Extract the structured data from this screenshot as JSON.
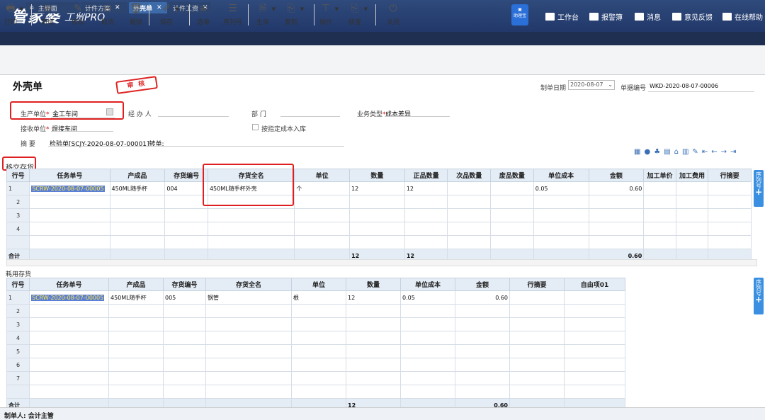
{
  "app": {
    "logo": "管家婆",
    "logo_sub": "工贸PRO",
    "assistant": "助理宝"
  },
  "topnav": [
    {
      "label": "工作台",
      "icon": "monitor-icon"
    },
    {
      "label": "报警簿",
      "icon": "alarm-icon"
    },
    {
      "label": "消息",
      "icon": "mail-icon"
    },
    {
      "label": "意见反馈",
      "icon": "edit-icon"
    },
    {
      "label": "在线帮助",
      "icon": "user-icon"
    }
  ],
  "tabs": [
    {
      "label": "主界面"
    },
    {
      "label": "计件方案"
    },
    {
      "label": "外壳单"
    },
    {
      "label": "计件工资"
    }
  ],
  "toolbar": [
    {
      "label": "打印",
      "icon": "print-icon",
      "glyph": "🖶"
    },
    {
      "label": "新增",
      "icon": "plus-circle-icon",
      "glyph": "⊕"
    },
    {
      "label": "修改",
      "icon": "edit-icon",
      "glyph": "✎"
    },
    {
      "label": "取消",
      "icon": "minus-circle-icon",
      "glyph": "⊖"
    },
    {
      "label": "删除",
      "icon": "trash-icon",
      "glyph": "🗑"
    },
    {
      "label": "保存",
      "icon": "save-icon",
      "glyph": "✐"
    },
    {
      "label": "选单",
      "icon": "select-icon",
      "glyph": "≡"
    },
    {
      "label": "序列号",
      "icon": "list-icon",
      "glyph": "☰"
    },
    {
      "label": "生单",
      "icon": "doc-icon",
      "glyph": "🗎"
    },
    {
      "label": "复制",
      "icon": "copy-icon",
      "glyph": "⎘"
    },
    {
      "label": "操作",
      "icon": "operate-icon",
      "glyph": "⊤"
    },
    {
      "label": "联查",
      "icon": "query-icon",
      "glyph": "⎘"
    },
    {
      "label": "关闭",
      "icon": "power-icon",
      "glyph": "⏻"
    }
  ],
  "header": {
    "title": "外壳单",
    "audit_stamp": "审 核",
    "date_label": "制单日期",
    "date_value": "2020-08-07",
    "no_label": "单据编号",
    "no_value": "WKD-2020-08-07-00006"
  },
  "form": {
    "prod_unit_label": "生产单位",
    "prod_unit_value": "金工车间",
    "handler_label": "经 办 人",
    "dept_label": "部  门",
    "biz_type_label": "业务类型",
    "biz_type_value": "成本差异",
    "recv_unit_label": "接收单位",
    "recv_unit_value": "焊接车间",
    "checkbox_label": "按指定成本入库",
    "summary_label": "摘  要",
    "summary_value": "检验单[SCJY-2020-08-07-00001]转单:"
  },
  "grid1": {
    "section": "移交存货",
    "columns": [
      "行号",
      "任务单号",
      "产成品",
      "存货编号",
      "存货全名",
      "单位",
      "数量",
      "正品数量",
      "次品数量",
      "废品数量",
      "单位成本",
      "金额",
      "加工单价",
      "加工费用",
      "行摘要"
    ],
    "rows": [
      [
        "1",
        "SCRW-2020-08-07-00005",
        "450ML随手杯",
        "004",
        "450ML随手杯外壳",
        "个",
        "12",
        "12",
        "",
        "",
        "0.05",
        "0.60",
        "",
        "",
        ""
      ],
      [
        "2",
        "",
        "",
        "",
        "",
        "",
        "",
        "",
        "",
        "",
        "",
        "",
        "",
        "",
        ""
      ],
      [
        "3",
        "",
        "",
        "",
        "",
        "",
        "",
        "",
        "",
        "",
        "",
        "",
        "",
        "",
        ""
      ],
      [
        "4",
        "",
        "",
        "",
        "",
        "",
        "",
        "",
        "",
        "",
        "",
        "",
        "",
        "",
        ""
      ],
      [
        "",
        "",
        "",
        "",
        "",
        "",
        "",
        "",
        "",
        "",
        "",
        "",
        "",
        "",
        ""
      ]
    ],
    "sum": [
      "合计",
      "",
      "",
      "",
      "",
      "",
      "12",
      "12",
      "",
      "",
      "",
      "0.60",
      "",
      "",
      ""
    ],
    "side_btn": "序列号"
  },
  "grid2": {
    "section": "耗用存货",
    "columns": [
      "行号",
      "任务单号",
      "产成品",
      "存货编号",
      "存货全名",
      "单位",
      "数量",
      "单位成本",
      "金额",
      "行摘要",
      "自由项01"
    ],
    "rows": [
      [
        "1",
        "SCRW-2020-08-07-00005",
        "450ML随手杯",
        "005",
        "钢管",
        "根",
        "12",
        "0.05",
        "0.60",
        "",
        ""
      ],
      [
        "2",
        "",
        "",
        "",
        "",
        "",
        "",
        "",
        "",
        "",
        ""
      ],
      [
        "3",
        "",
        "",
        "",
        "",
        "",
        "",
        "",
        "",
        "",
        ""
      ],
      [
        "4",
        "",
        "",
        "",
        "",
        "",
        "",
        "",
        "",
        "",
        ""
      ],
      [
        "5",
        "",
        "",
        "",
        "",
        "",
        "",
        "",
        "",
        "",
        ""
      ],
      [
        "6",
        "",
        "",
        "",
        "",
        "",
        "",
        "",
        "",
        "",
        ""
      ],
      [
        "7",
        "",
        "",
        "",
        "",
        "",
        "",
        "",
        "",
        "",
        ""
      ],
      [
        "",
        "",
        "",
        "",
        "",
        "",
        "",
        "",
        "",
        "",
        ""
      ]
    ],
    "sum": [
      "合计",
      "",
      "",
      "",
      "",
      "",
      "12",
      "",
      "0.60",
      "",
      ""
    ],
    "side_btn": "序列号"
  },
  "footer": {
    "maker": "制单人: 会计主管"
  }
}
